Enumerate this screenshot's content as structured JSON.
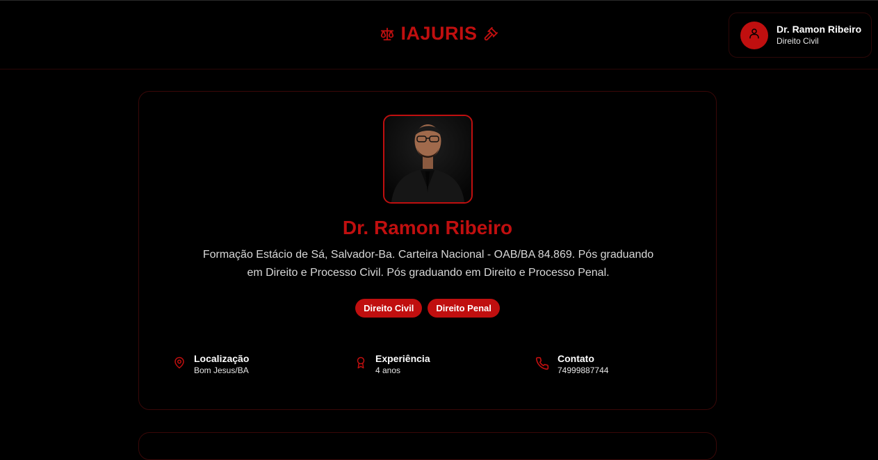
{
  "header": {
    "brand_title": "IAJURIS",
    "brand_color": "#c00f0f"
  },
  "user": {
    "name": "Dr. Ramon Ribeiro",
    "role": "Direito Civil"
  },
  "profile": {
    "name": "Dr. Ramon Ribeiro",
    "bio": "Formação Estácio de Sá, Salvador-Ba. Carteira Nacional - OAB/BA 84.869. Pós graduando em Direito e Processo Civil. Pós graduando em Direito e Processo Penal.",
    "tags": [
      "Direito Civil",
      "Direito Penal"
    ],
    "info": [
      {
        "label": "Localização",
        "value": "Bom Jesus/BA",
        "icon": "map-pin-icon"
      },
      {
        "label": "Experiência",
        "value": "4 anos",
        "icon": "award-icon"
      },
      {
        "label": "Contato",
        "value": "74999887744",
        "icon": "phone-icon"
      }
    ]
  },
  "colors": {
    "accent": "#c00f0f",
    "background": "#000000",
    "border": "#3a0808"
  }
}
